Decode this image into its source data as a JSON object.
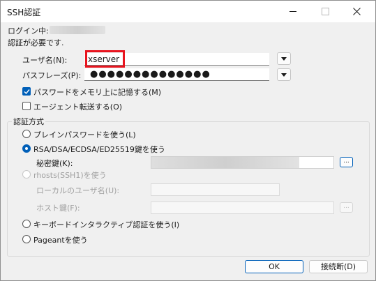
{
  "window": {
    "title": "SSH認証"
  },
  "login_label": "ログイン中:",
  "auth_required": "認証が必要です.",
  "username": {
    "label": "ユーザ名(N):",
    "value": "xserver"
  },
  "passphrase": {
    "label": "パスフレーズ(P):",
    "masked_value": "●●●●●●●●●●●●●●"
  },
  "save_password": {
    "label": "パスワードをメモリ上に記憶する(M)",
    "checked": true
  },
  "agent_forward": {
    "label": "エージェント転送する(O)",
    "checked": false
  },
  "auth_method": {
    "group_label": "認証方式",
    "plain_password": "プレインパスワードを使う(L)",
    "rsa_key": "RSA/DSA/ECDSA/ED25519鍵を使う",
    "private_key_label": "秘密鍵(K):",
    "browse_label": "...",
    "rhosts": "rhosts(SSH1)を使う",
    "local_user_label": "ローカルのユーザ名(U):",
    "host_key_label": "ホスト鍵(F):",
    "keyboard_interactive": "キーボードインタラクティブ認証を使う(I)",
    "pageant": "Pageantを使う",
    "selected": "rsa_key"
  },
  "buttons": {
    "ok": "OK",
    "disconnect": "接続断(D)"
  },
  "colors": {
    "accent": "#005fb8",
    "highlight": "#e8141e"
  }
}
